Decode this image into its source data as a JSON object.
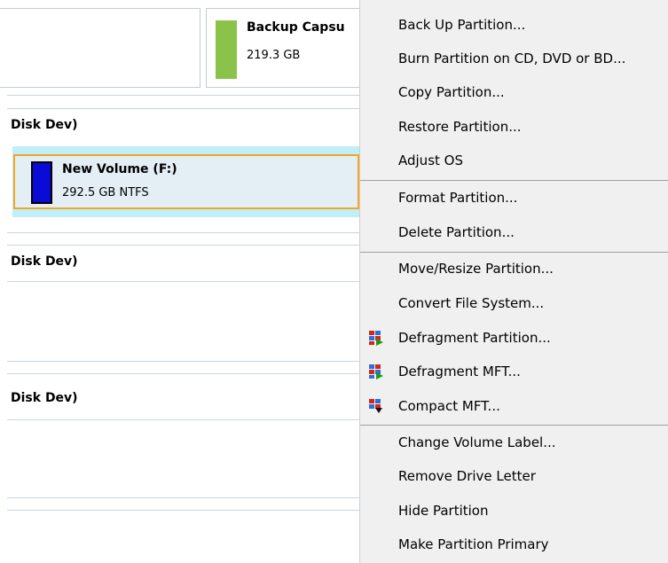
{
  "disk_panel": {
    "top_card": {
      "partition_name": "Backup Capsu",
      "size": "219.3 GB",
      "color": "#8bc34a"
    },
    "disks": [
      {
        "label": "Disk Dev)"
      },
      {
        "label": "Disk Dev)"
      },
      {
        "label": "Disk Dev)"
      }
    ],
    "selected_partition": {
      "name": "New Volume (F:)",
      "details": "292.5 GB NTFS",
      "color": "#0b0bd8",
      "highlight_border": "#f5a623",
      "highlight_bg": "#bfeffa"
    }
  },
  "context_menu": {
    "items": [
      {
        "label": "Back Up Partition..."
      },
      {
        "label": "Burn Partition on CD, DVD or BD..."
      },
      {
        "label": "Copy Partition..."
      },
      {
        "label": "Restore Partition..."
      },
      {
        "label": "Adjust OS"
      },
      {
        "label": "Format Partition..."
      },
      {
        "label": "Delete Partition..."
      },
      {
        "label": "Move/Resize Partition..."
      },
      {
        "label": "Convert File System..."
      },
      {
        "label": "Defragment Partition...",
        "icon": "defragment-icon"
      },
      {
        "label": "Defragment MFT...",
        "icon": "defragment-mft-icon"
      },
      {
        "label": "Compact MFT...",
        "icon": "compact-mft-icon"
      },
      {
        "label": "Change Volume Label..."
      },
      {
        "label": "Remove Drive Letter"
      },
      {
        "label": "Hide Partition"
      },
      {
        "label": "Make Partition Primary"
      }
    ]
  }
}
